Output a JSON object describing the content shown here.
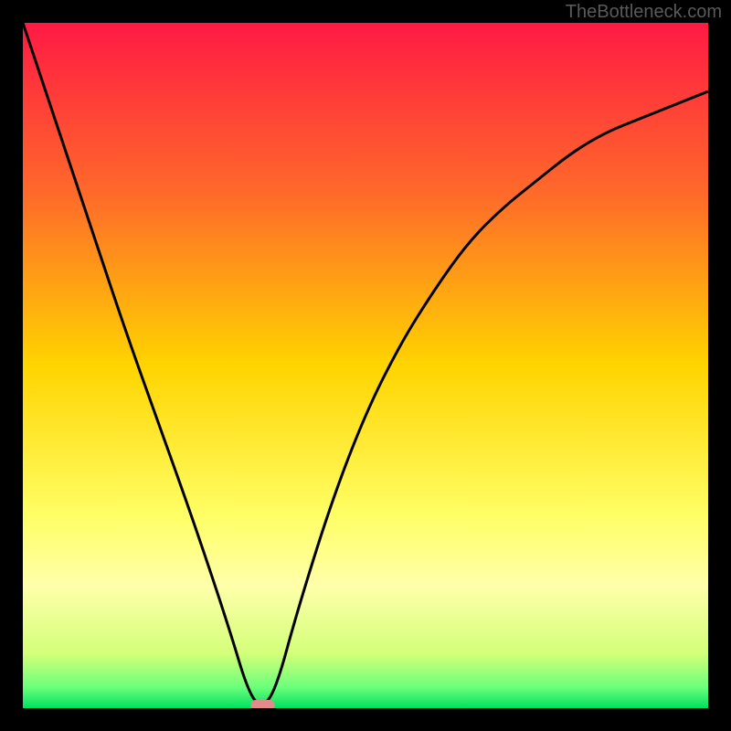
{
  "watermark": "TheBottleneck.com",
  "chart_data": {
    "type": "line",
    "title": "",
    "xlabel": "",
    "ylabel": "",
    "xlim": [
      0,
      100
    ],
    "ylim": [
      0,
      100
    ],
    "x": [
      0,
      5,
      10,
      15,
      20,
      25,
      30,
      33,
      35,
      37,
      40,
      45,
      50,
      55,
      60,
      65,
      70,
      75,
      80,
      85,
      90,
      95,
      100
    ],
    "values": [
      100,
      85,
      70,
      55,
      41,
      27,
      12,
      2,
      0,
      3,
      14,
      30,
      43,
      53,
      61,
      68,
      73,
      77,
      81,
      84,
      86,
      88,
      90
    ],
    "min_marker": {
      "x": 35,
      "y": 0
    },
    "gradient_stops": [
      {
        "offset": 0,
        "color": "#ff1a44"
      },
      {
        "offset": 25,
        "color": "#ff6a2a"
      },
      {
        "offset": 50,
        "color": "#ffd400"
      },
      {
        "offset": 72,
        "color": "#ffff66"
      },
      {
        "offset": 82,
        "color": "#ffffaa"
      },
      {
        "offset": 92,
        "color": "#d4ff7a"
      },
      {
        "offset": 97,
        "color": "#6aff7a"
      },
      {
        "offset": 100,
        "color": "#00e060"
      }
    ]
  }
}
